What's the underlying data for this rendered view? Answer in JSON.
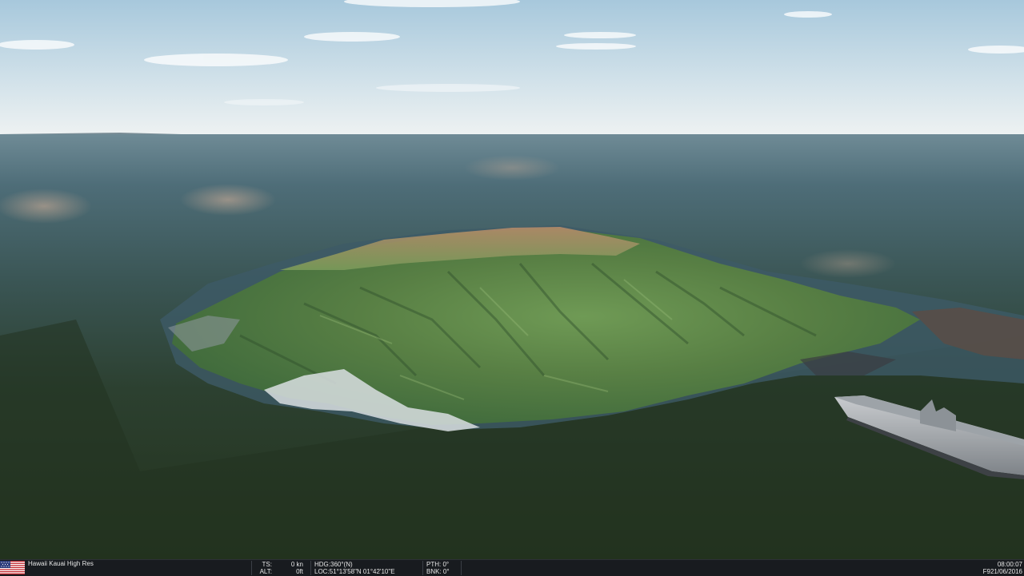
{
  "scenario": {
    "name": "Hawaii Kauai High Res",
    "flag": "us-flag-icon"
  },
  "status": {
    "ts_label": "TS:",
    "ts_value": "0 kn",
    "alt_label": "ALT:",
    "alt_value": "0ft",
    "hdg": "HDG:360°(N)",
    "loc": "LOC:51°13'58\"N 01°42'10\"E",
    "pth": "PTH: 0°",
    "bnk": "BNK: 0°",
    "time": "08:00:07",
    "date": "F921/06/2016"
  },
  "colors": {
    "sky_top": "#a9c9dc",
    "sky_horizon": "#e8eff2",
    "sea_far": "#4f6f7c",
    "sea_near": "#27381f",
    "island_green": "#5e8c4a",
    "status_bg": "#181b1f"
  }
}
